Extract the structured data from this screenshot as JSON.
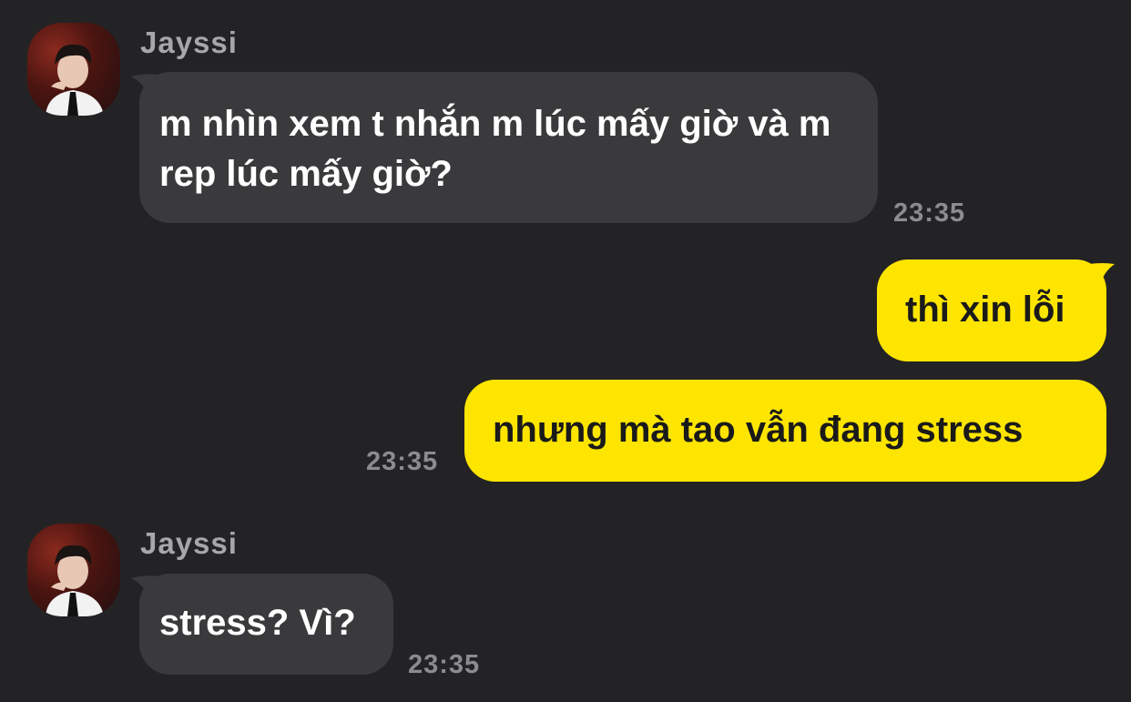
{
  "colors": {
    "background": "#232325",
    "incoming_bubble": "#3a3a3c",
    "outgoing_bubble": "#fee500",
    "sender_name": "#a7a7aa",
    "timestamp": "#8c8c90"
  },
  "messages": [
    {
      "direction": "incoming",
      "sender": "Jayssi",
      "text": "m nhìn xem t nhắn m lúc mấy giờ và m rep lúc mấy giờ?",
      "time": "23:35"
    },
    {
      "direction": "outgoing",
      "text": "thì xin lỗi"
    },
    {
      "direction": "outgoing",
      "text": "nhưng mà tao vẫn đang stress",
      "time": "23:35"
    },
    {
      "direction": "incoming",
      "sender": "Jayssi",
      "text": "stress? Vì?",
      "time": "23:35"
    }
  ]
}
